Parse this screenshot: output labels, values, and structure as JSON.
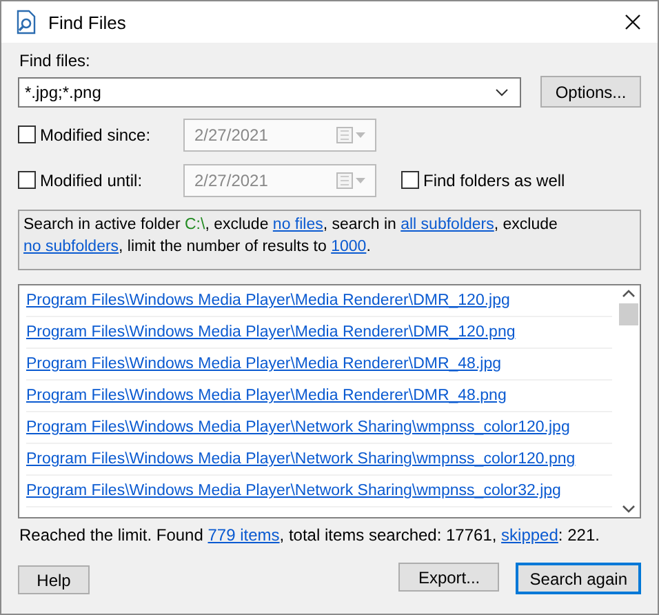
{
  "window": {
    "title": "Find Files"
  },
  "find_files": {
    "label": "Find files:",
    "value": "*.jpg;*.png",
    "options_button": "Options..."
  },
  "date_filters": [
    {
      "label": "Modified since:",
      "checked": false,
      "date": "2/27/2021",
      "disabled": true
    },
    {
      "label": "Modified until:",
      "checked": false,
      "date": "2/27/2021",
      "disabled": true
    }
  ],
  "find_folders": {
    "label": "Find folders as well",
    "checked": false
  },
  "search_summary": [
    {
      "kind": "text",
      "text": "Search in active folder "
    },
    {
      "kind": "path",
      "text": "C:\\"
    },
    {
      "kind": "text",
      "text": ", exclude "
    },
    {
      "kind": "link",
      "text": "no files"
    },
    {
      "kind": "text",
      "text": ", search in "
    },
    {
      "kind": "link",
      "text": "all subfolders"
    },
    {
      "kind": "text",
      "text": ", exclude "
    },
    {
      "kind": "link",
      "text": "no subfolders"
    },
    {
      "kind": "text",
      "text": ", limit the number of results to "
    },
    {
      "kind": "link",
      "text": "1000"
    },
    {
      "kind": "text",
      "text": "."
    }
  ],
  "results": [
    "Program Files\\Windows Media Player\\Media Renderer\\DMR_120.jpg",
    "Program Files\\Windows Media Player\\Media Renderer\\DMR_120.png",
    "Program Files\\Windows Media Player\\Media Renderer\\DMR_48.jpg",
    "Program Files\\Windows Media Player\\Media Renderer\\DMR_48.png",
    "Program Files\\Windows Media Player\\Network Sharing\\wmpnss_color120.jpg",
    "Program Files\\Windows Media Player\\Network Sharing\\wmpnss_color120.png",
    "Program Files\\Windows Media Player\\Network Sharing\\wmpnss_color32.jpg"
  ],
  "status": [
    {
      "kind": "text",
      "text": "Reached the limit. Found "
    },
    {
      "kind": "link",
      "text": "779 items"
    },
    {
      "kind": "text",
      "text": ", total items searched: 17761, "
    },
    {
      "kind": "link",
      "text": "skipped"
    },
    {
      "kind": "text",
      "text": ": 221."
    }
  ],
  "buttons": {
    "help": "Help",
    "export": "Export...",
    "search": "Search again"
  }
}
